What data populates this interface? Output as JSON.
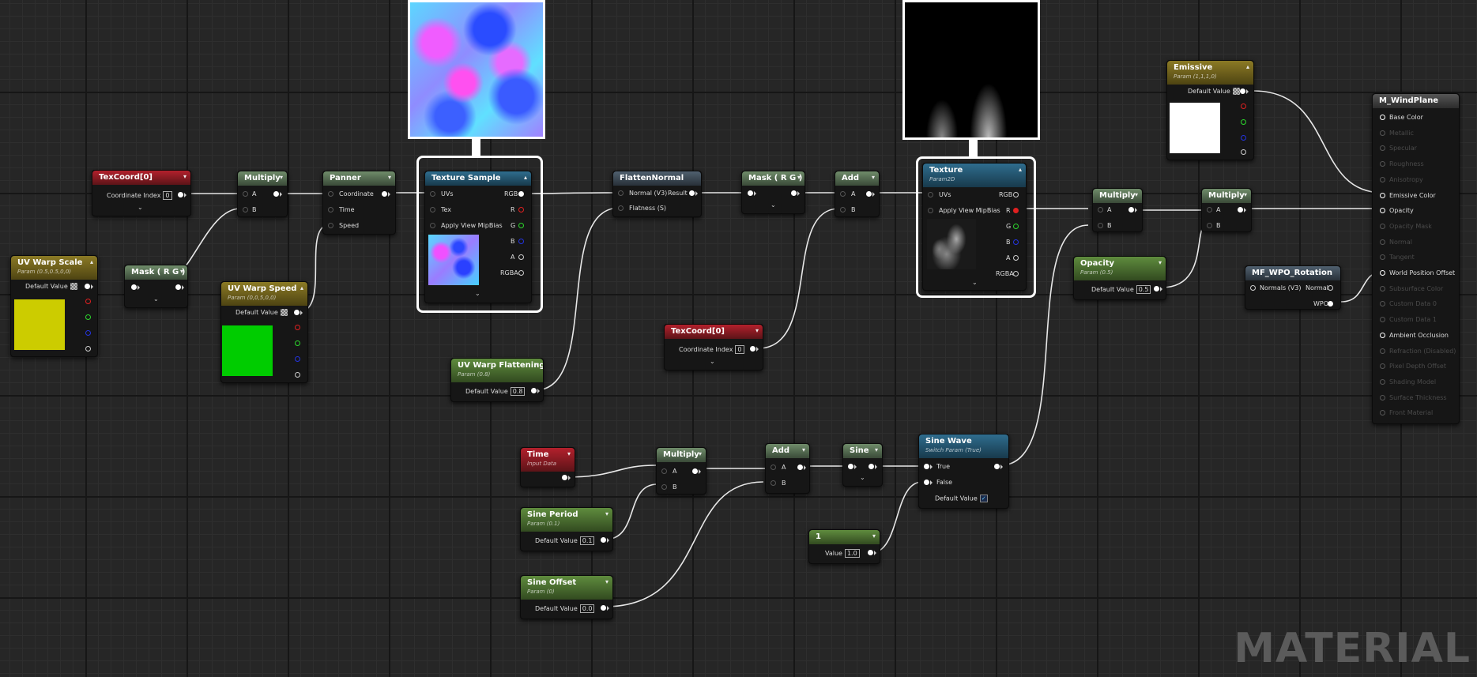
{
  "watermark": "MATERIAL",
  "nodes": {
    "texcoord1": {
      "title": "TexCoord[0]",
      "label": "Coordinate Index",
      "value": "0"
    },
    "uvwarpscale": {
      "title": "UV Warp Scale",
      "subtitle": "Param (0.5,0.5,0,0)",
      "label": "Default Value",
      "color": "#cccc00"
    },
    "mask1": {
      "title": "Mask ( R G )"
    },
    "multiply1": {
      "title": "Multiply",
      "a": "A",
      "b": "B"
    },
    "uvwarpspeed": {
      "title": "UV Warp Speed",
      "subtitle": "Param (0,0,5,0,0)",
      "label": "Default Value",
      "color": "#00cc00"
    },
    "panner": {
      "title": "Panner",
      "coordinate": "Coordinate",
      "time": "Time",
      "speed": "Speed"
    },
    "texsample": {
      "title": "Texture Sample",
      "uvs": "UVs",
      "tex": "Tex",
      "mip": "Apply View MipBias",
      "rgb": "RGB",
      "r": "R",
      "g": "G",
      "b": "B",
      "a": "A",
      "rgba": "RGBA"
    },
    "uvwarpflat": {
      "title": "UV Warp Flattening",
      "subtitle": "Param (0.8)",
      "label": "Default Value",
      "value": "0.8"
    },
    "flatten": {
      "title": "FlattenNormal",
      "normal": "Normal (V3)",
      "result": "Result",
      "flatness": "Flatness (S)"
    },
    "mask2": {
      "title": "Mask ( R G )"
    },
    "add1": {
      "title": "Add",
      "a": "A",
      "b": "B"
    },
    "texcoord2": {
      "title": "TexCoord[0]",
      "label": "Coordinate Index",
      "value": "0"
    },
    "texture": {
      "title": "Texture",
      "subtitle": "Param2D",
      "uvs": "UVs",
      "mip": "Apply View MipBias",
      "rgb": "RGB",
      "r": "R",
      "g": "G",
      "b": "B",
      "a": "A",
      "rgba": "RGBA"
    },
    "multiply2": {
      "title": "Multiply",
      "a": "A",
      "b": "B"
    },
    "multiply3": {
      "title": "Multiply",
      "a": "A",
      "b": "B"
    },
    "opacity": {
      "title": "Opacity",
      "subtitle": "Param (0.5)",
      "label": "Default Value",
      "value": "0.5"
    },
    "emissive": {
      "title": "Emissive",
      "subtitle": "Param (1,1,1,0)",
      "label": "Default Value",
      "color": "#ffffff"
    },
    "mfwpo": {
      "title": "MF_WPO_Rotation",
      "normals": "Normals (V3)",
      "normal": "Normal",
      "wpo": "WPO"
    },
    "time": {
      "title": "Time",
      "subtitle": "Input Data"
    },
    "multiply4": {
      "title": "Multiply",
      "a": "A",
      "b": "B"
    },
    "add2": {
      "title": "Add",
      "a": "A",
      "b": "B"
    },
    "sine": {
      "title": "Sine"
    },
    "sinewave": {
      "title": "Sine Wave",
      "subtitle": "Switch Param (True)",
      "true": "True",
      "false": "False",
      "label": "Default Value"
    },
    "sineperiod": {
      "title": "Sine Period",
      "subtitle": "Param (0.1)",
      "label": "Default Value",
      "value": "0.1"
    },
    "sineoffset": {
      "title": "Sine Offset",
      "subtitle": "Param (0)",
      "label": "Default Value",
      "value": "0.0"
    },
    "const1": {
      "title": "1",
      "label": "Value",
      "value": "1.0"
    },
    "result": {
      "title": "M_WindPlane",
      "inputs": [
        {
          "label": "Base Color",
          "active": true
        },
        {
          "label": "Metallic",
          "active": false
        },
        {
          "label": "Specular",
          "active": false
        },
        {
          "label": "Roughness",
          "active": false
        },
        {
          "label": "Anisotropy",
          "active": false
        },
        {
          "label": "Emissive Color",
          "active": true
        },
        {
          "label": "Opacity",
          "active": true
        },
        {
          "label": "Opacity Mask",
          "active": false
        },
        {
          "label": "Normal",
          "active": false
        },
        {
          "label": "Tangent",
          "active": false
        },
        {
          "label": "World Position Offset",
          "active": true
        },
        {
          "label": "Subsurface Color",
          "active": false
        },
        {
          "label": "Custom Data 0",
          "active": false
        },
        {
          "label": "Custom Data 1",
          "active": false
        },
        {
          "label": "Ambient Occlusion",
          "active": true
        },
        {
          "label": "Refraction (Disabled)",
          "active": false
        },
        {
          "label": "Pixel Depth Offset",
          "active": false
        },
        {
          "label": "Shading Model",
          "active": false
        },
        {
          "label": "Surface Thickness",
          "active": false
        },
        {
          "label": "Front Material",
          "active": false
        }
      ]
    }
  }
}
